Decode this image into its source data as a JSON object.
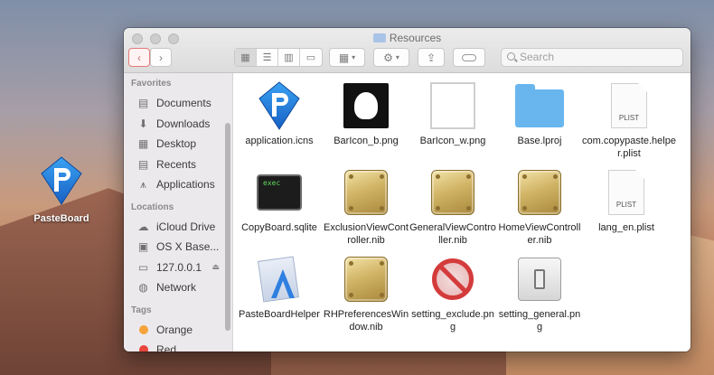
{
  "desktop": {
    "icon_label": "PasteBoard"
  },
  "window": {
    "title": "Resources",
    "search_placeholder": "Search"
  },
  "sidebar": {
    "favorites_header": "Favorites",
    "favorites": [
      {
        "label": "Documents",
        "icon": "documents-icon"
      },
      {
        "label": "Downloads",
        "icon": "downloads-icon"
      },
      {
        "label": "Desktop",
        "icon": "desktop-icon"
      },
      {
        "label": "Recents",
        "icon": "recents-icon"
      },
      {
        "label": "Applications",
        "icon": "applications-icon"
      }
    ],
    "locations_header": "Locations",
    "locations": [
      {
        "label": "iCloud Drive",
        "icon": "cloud-icon"
      },
      {
        "label": "OS X Base...",
        "icon": "disk-icon"
      },
      {
        "label": "127.0.0.1",
        "icon": "display-icon"
      },
      {
        "label": "Network",
        "icon": "network-icon"
      }
    ],
    "tags_header": "Tags",
    "tags": [
      {
        "label": "Orange",
        "color": "#f5a33a"
      },
      {
        "label": "Red",
        "color": "#e8453c"
      }
    ]
  },
  "files": [
    {
      "name": "application.icns",
      "kind": "app-logo"
    },
    {
      "name": "BarIcon_b.png",
      "kind": "bar-black"
    },
    {
      "name": "BarIcon_w.png",
      "kind": "bar-white"
    },
    {
      "name": "Base.lproj",
      "kind": "folder"
    },
    {
      "name": "com.copypaste.helper.plist",
      "kind": "plist",
      "tag": "PLIST"
    },
    {
      "name": "CopyBoard.sqlite",
      "kind": "exec",
      "tag": "exec"
    },
    {
      "name": "ExclusionViewController.nib",
      "kind": "nib"
    },
    {
      "name": "GeneralViewController.nib",
      "kind": "nib"
    },
    {
      "name": "HomeViewController.nib",
      "kind": "nib"
    },
    {
      "name": "lang_en.plist",
      "kind": "plist",
      "tag": "PLIST"
    },
    {
      "name": "PasteBoardHelper",
      "kind": "xcode-app"
    },
    {
      "name": "RHPreferencesWindow.nib",
      "kind": "nib"
    },
    {
      "name": "setting_exclude.png",
      "kind": "no-sign"
    },
    {
      "name": "setting_general.png",
      "kind": "toggle"
    }
  ]
}
